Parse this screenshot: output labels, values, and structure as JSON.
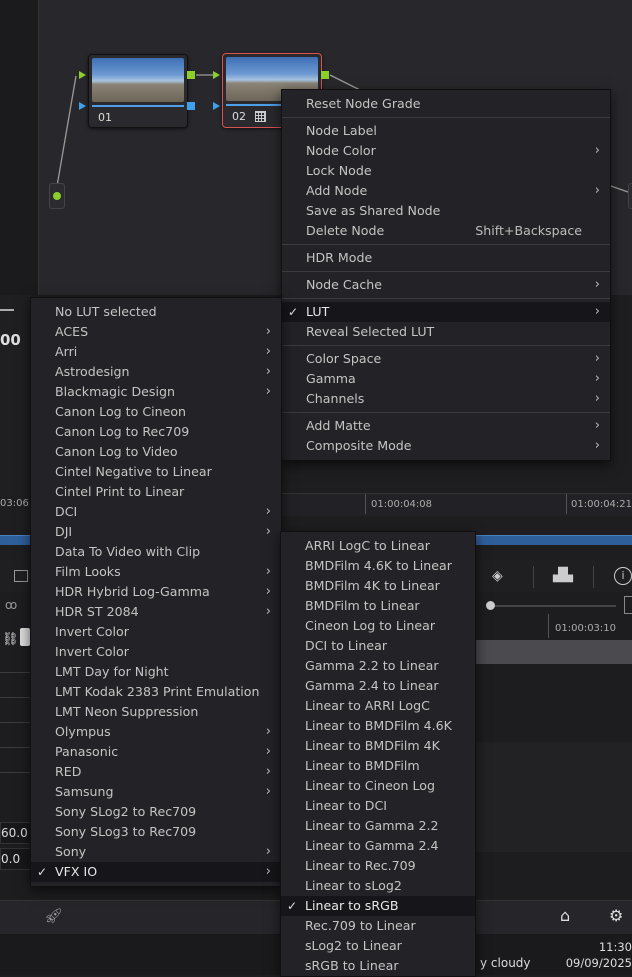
{
  "nodes": [
    {
      "number": "01"
    },
    {
      "number": "02",
      "grid_icon": "grid-icon"
    }
  ],
  "left_panel": {
    "timecode_fragment": "00",
    "ruler_tick": "03:06",
    "value_1": "60.0",
    "value_2": "0.0"
  },
  "timeline": {
    "ruler_ticks": [
      "01:00:04:08",
      "01:00:04:21"
    ],
    "lower_tick": "01:00:03:10"
  },
  "context_menu": {
    "items": [
      {
        "label": "Reset Node Grade"
      },
      {
        "label": "Node Label"
      },
      {
        "label": "Node Color",
        "submenu": true
      },
      {
        "label": "Lock Node"
      },
      {
        "label": "Add Node",
        "submenu": true
      },
      {
        "label": "Save as Shared Node"
      },
      {
        "label": "Delete Node",
        "shortcut": "Shift+Backspace"
      },
      {
        "label": "HDR Mode"
      },
      {
        "label": "Node Cache",
        "submenu": true
      },
      {
        "label": "LUT",
        "submenu": true,
        "checked": true,
        "selected": true
      },
      {
        "label": "Reveal Selected LUT"
      },
      {
        "label": "Color Space",
        "submenu": true
      },
      {
        "label": "Gamma",
        "submenu": true
      },
      {
        "label": "Channels",
        "submenu": true
      },
      {
        "label": "Add Matte",
        "submenu": true
      },
      {
        "label": "Composite Mode",
        "submenu": true
      }
    ]
  },
  "lut_menu": {
    "items": [
      {
        "label": "No LUT selected"
      },
      {
        "label": "ACES",
        "submenu": true
      },
      {
        "label": "Arri",
        "submenu": true
      },
      {
        "label": "Astrodesign",
        "submenu": true
      },
      {
        "label": "Blackmagic Design",
        "submenu": true
      },
      {
        "label": "Canon Log to Cineon"
      },
      {
        "label": "Canon Log to Rec709"
      },
      {
        "label": "Canon Log to Video"
      },
      {
        "label": "Cintel Negative to Linear"
      },
      {
        "label": "Cintel Print to Linear"
      },
      {
        "label": "DCI",
        "submenu": true
      },
      {
        "label": "DJI",
        "submenu": true
      },
      {
        "label": "Data To Video with Clip"
      },
      {
        "label": "Film Looks",
        "submenu": true
      },
      {
        "label": "HDR Hybrid Log-Gamma",
        "submenu": true
      },
      {
        "label": "HDR ST 2084",
        "submenu": true
      },
      {
        "label": "Invert Color"
      },
      {
        "label": "Invert Color"
      },
      {
        "label": "LMT Day for Night"
      },
      {
        "label": "LMT Kodak 2383 Print Emulation"
      },
      {
        "label": "LMT Neon Suppression"
      },
      {
        "label": "Olympus",
        "submenu": true
      },
      {
        "label": "Panasonic",
        "submenu": true
      },
      {
        "label": "RED",
        "submenu": true
      },
      {
        "label": "Samsung",
        "submenu": true
      },
      {
        "label": "Sony SLog2 to Rec709"
      },
      {
        "label": "Sony SLog3 to Rec709"
      },
      {
        "label": "Sony",
        "submenu": true
      },
      {
        "label": "VFX IO",
        "submenu": true,
        "checked": true,
        "selected": true
      }
    ]
  },
  "vfx_menu": {
    "items": [
      {
        "label": "ARRI LogC to Linear"
      },
      {
        "label": "BMDFilm 4.6K to Linear"
      },
      {
        "label": "BMDFilm 4K to Linear"
      },
      {
        "label": "BMDFilm to Linear"
      },
      {
        "label": "Cineon Log to Linear"
      },
      {
        "label": "DCI to Linear"
      },
      {
        "label": "Gamma 2.2 to Linear"
      },
      {
        "label": "Gamma 2.4 to Linear"
      },
      {
        "label": "Linear to ARRI LogC"
      },
      {
        "label": "Linear to BMDFilm 4.6K"
      },
      {
        "label": "Linear to BMDFilm 4K"
      },
      {
        "label": "Linear to BMDFilm"
      },
      {
        "label": "Linear to Cineon Log"
      },
      {
        "label": "Linear to DCI"
      },
      {
        "label": "Linear to Gamma 2.2"
      },
      {
        "label": "Linear to Gamma 2.4"
      },
      {
        "label": "Linear to Rec.709"
      },
      {
        "label": "Linear to sLog2"
      },
      {
        "label": "Linear to sRGB",
        "checked": true,
        "selected": true
      },
      {
        "label": "Rec.709 to Linear"
      },
      {
        "label": "sLog2 to Linear"
      },
      {
        "label": "sRGB to Linear"
      }
    ]
  },
  "status": {
    "weather": "y cloudy",
    "time": "11:30",
    "date": "09/09/2025"
  },
  "icons": {
    "rocket": "rocket-icon",
    "home": "home-icon",
    "settings": "gear-icon",
    "link": "link-icon",
    "info": "info-icon",
    "scope": "waveform-icon",
    "grade": "diamond-icon"
  },
  "colors": {
    "accent_blue": "#3ea1ea",
    "node_green": "#8bcf2a",
    "selected_node_border": "#d9534f"
  }
}
